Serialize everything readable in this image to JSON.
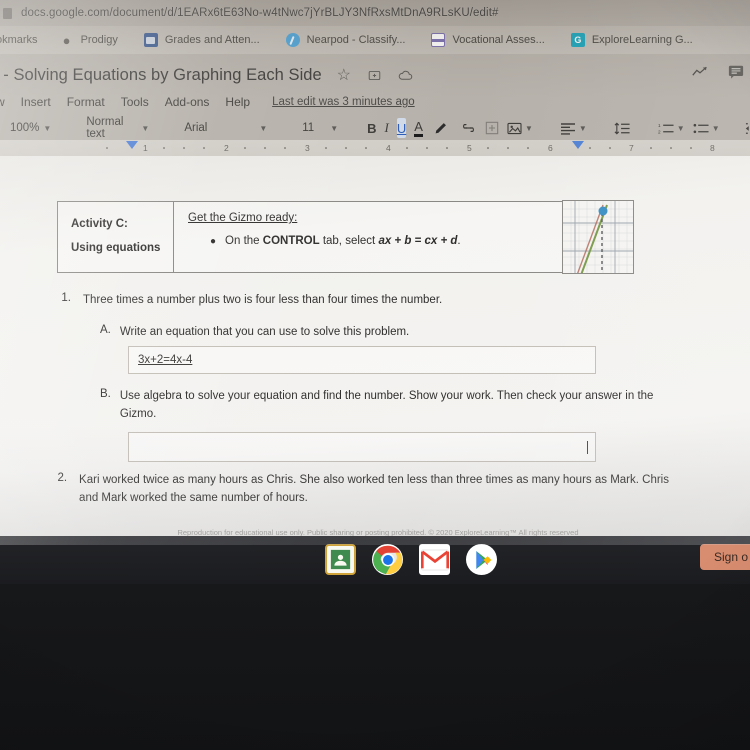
{
  "browser": {
    "url": "docs.google.com/document/d/1EARx6tE63No-w4tNwc7jYrBLJY3NfRxsMtDnA9RLsKU/edit#",
    "bookmarks_cut_label": "okmarks",
    "bookmarks": [
      {
        "label": "Prodigy",
        "icon": "prodigy-icon"
      },
      {
        "label": "Grades and Atten...",
        "icon": "grades-icon"
      },
      {
        "label": "Nearpod - Classify...",
        "icon": "nearpod-icon"
      },
      {
        "label": "Vocational Asses...",
        "icon": "vocational-icon"
      },
      {
        "label": "ExploreLearning G...",
        "icon": "explorelearning-icon"
      }
    ]
  },
  "docs": {
    "title": "t - Solving Equations by Graphing Each Side",
    "title_icons": [
      "star-icon",
      "move-to-folder-icon",
      "cloud-status-icon"
    ],
    "right_icons": [
      "activity-dashboard-icon",
      "comment-icon"
    ],
    "menu": [
      "w",
      "Insert",
      "Format",
      "Tools",
      "Add-ons",
      "Help"
    ],
    "last_edit": "Last edit was 3 minutes ago",
    "toolbar": {
      "zoom": "100%",
      "style": "Normal text",
      "font": "Arial",
      "size": "11",
      "bold": "B",
      "italic": "I",
      "underline": "U",
      "text_color": "A",
      "highlight": "highlight-pen-icon",
      "link": "link-icon",
      "comment": "add-comment-icon",
      "image": "insert-image-icon",
      "align": "align-left-icon",
      "line_spacing": "line-spacing-icon",
      "numbered_list": "numbered-list-icon",
      "bulleted_list": "bulleted-list-icon",
      "indent_less": "decrease-indent-icon",
      "indent_more": "increase-indent-icon"
    },
    "ruler_ticks": [
      "1",
      "2",
      "3",
      "4",
      "5",
      "6",
      "7",
      "8"
    ]
  },
  "document": {
    "activity": {
      "label_line1": "Activity C:",
      "label_line2": "Using equations",
      "heading": "Get the Gizmo ready:",
      "bullet_prefix": "On the ",
      "bullet_bold": "CONTROL",
      "bullet_mid": " tab, select ",
      "bullet_equation": "ax + b = cx + d",
      "bullet_suffix": "."
    },
    "questions": [
      {
        "number": "1.",
        "text": "Three times a number plus two is four less than four times the number.",
        "subparts": [
          {
            "label": "A.",
            "text": "Write an equation that you can use to solve this problem.",
            "answer": "3x+2=4x-4"
          },
          {
            "label": "B.",
            "text": "Use algebra to solve your equation and find the number. Show your work. Then check your answer in the Gizmo.",
            "answer": ""
          }
        ]
      },
      {
        "number": "2.",
        "text": "Kari worked twice as many hours as Chris. She also worked ten less than three times as many hours as Mark. Chris and Mark worked the same number of hours.",
        "subparts": []
      }
    ],
    "footer": "Reproduction for educational use only. Public sharing or posting prohibited. © 2020 ExploreLearning™ All rights reserved"
  },
  "shelf": {
    "apps": [
      {
        "name": "google-classroom",
        "label": "Classroom"
      },
      {
        "name": "google-chrome",
        "label": "Chrome"
      },
      {
        "name": "gmail",
        "label": "Gmail"
      },
      {
        "name": "google-play",
        "label": "Play Store"
      }
    ],
    "sign_out_label": "Sign o"
  },
  "colors": {
    "accent_blue": "#3b73d6",
    "sign_out_bg": "#d98d70",
    "shelf_bg": "#1b1c1f",
    "page_bg": "#f2f1ee"
  }
}
